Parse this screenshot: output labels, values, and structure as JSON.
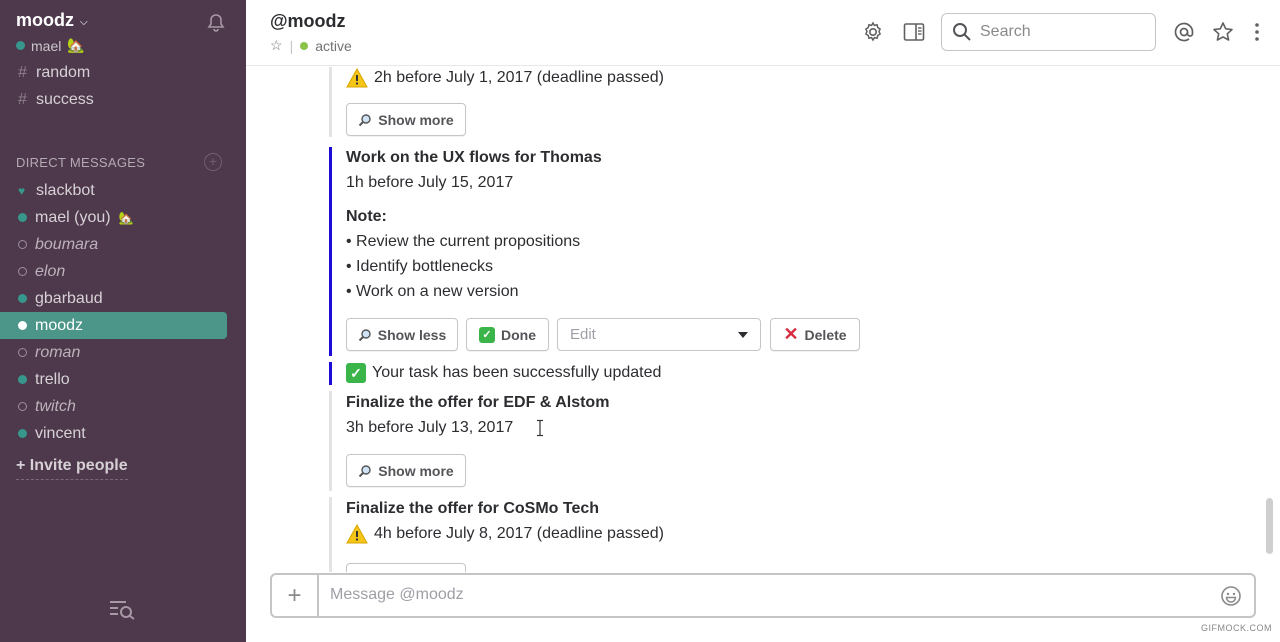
{
  "sidebar": {
    "team_name": "moodz",
    "current_user": "mael",
    "current_user_emoji": "🏡",
    "channels": [
      {
        "name": "random"
      },
      {
        "name": "success"
      }
    ],
    "dm_heading": "DIRECT MESSAGES",
    "dms": [
      {
        "name": "slackbot",
        "status": "bot"
      },
      {
        "name": "mael (you)",
        "status": "online",
        "emoji": "🏡"
      },
      {
        "name": "boumara",
        "status": "away"
      },
      {
        "name": "elon",
        "status": "away"
      },
      {
        "name": "gbarbaud",
        "status": "online"
      },
      {
        "name": "moodz",
        "status": "active"
      },
      {
        "name": "roman",
        "status": "away"
      },
      {
        "name": "trello",
        "status": "online"
      },
      {
        "name": "twitch",
        "status": "away"
      },
      {
        "name": "vincent",
        "status": "online"
      }
    ],
    "invite_label": "+ Invite people"
  },
  "header": {
    "title": "@moodz",
    "presence": "active",
    "separator": "|",
    "search_placeholder": "Search"
  },
  "messages": {
    "task0": {
      "due": "2h before July 1, 2017 (deadline passed)",
      "show_more": "Show more"
    },
    "task1": {
      "title": "Work on the UX flows for Thomas",
      "due": "1h before July 15, 2017",
      "note_label": "Note:",
      "note_items": [
        "• Review the current propositions",
        "• Identify bottlenecks",
        "• Work on a new version"
      ],
      "show_less": "Show less",
      "done": "Done",
      "edit_placeholder": "Edit",
      "delete": "Delete"
    },
    "confirmation": "Your task has been successfully updated",
    "task2": {
      "title": "Finalize the offer for EDF & Alstom",
      "due": "3h before July 13, 2017",
      "show_more": "Show more"
    },
    "task3": {
      "title": "Finalize the offer for CoSMo Tech",
      "due": "4h before July 8, 2017 (deadline passed)"
    }
  },
  "composer": {
    "placeholder": "Message @moodz",
    "plus": "+"
  },
  "watermark": "GIFMOCK.COM",
  "colors": {
    "sidebar_bg": "#4d394b",
    "active_item": "#4c9689",
    "online": "#38978d",
    "accent_bar": "#1d0bd6"
  }
}
